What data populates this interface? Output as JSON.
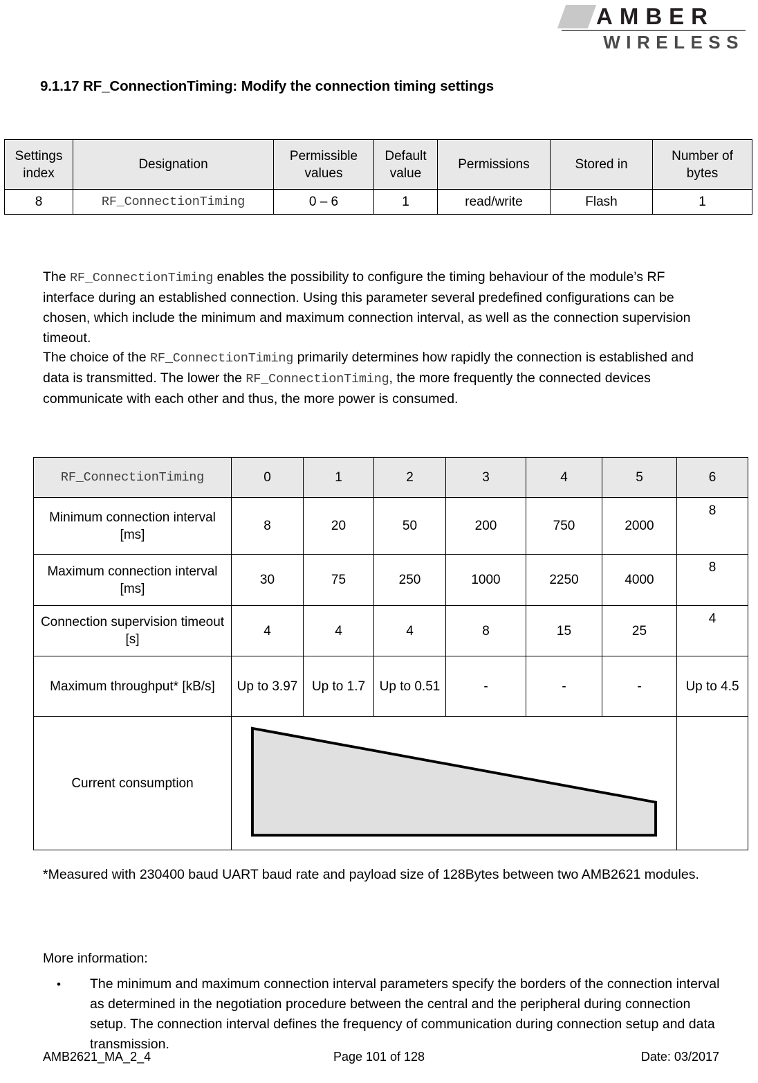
{
  "logo": {
    "line1": "AMBER",
    "line2": "WIRELESS"
  },
  "heading": "9.1.17 RF_ConnectionTiming: Modify the connection timing settings",
  "settings_table": {
    "headers": [
      "Settings index",
      "Designation",
      "Permissible values",
      "Default value",
      "Permissions",
      "Stored in",
      "Number of bytes"
    ],
    "row": {
      "settings_index": "8",
      "designation": "RF_ConnectionTiming",
      "permissible_values": "0 – 6",
      "default_value": "1",
      "permissions": "read/write",
      "stored_in": "Flash",
      "number_of_bytes": "1"
    }
  },
  "paragraphs": {
    "p1": {
      "a": "The ",
      "code1": "RF_ConnectionTiming",
      "b": " enables the possibility to configure the timing behaviour of the module’s RF interface during an established connection. Using this parameter several predefined configurations can be chosen, which include the minimum and maximum connection interval, as well as the connection supervision timeout."
    },
    "p2": {
      "a": "The choice of the ",
      "code1": "RF_ConnectionTiming",
      "b": " primarily determines how rapidly the connection is established and data is transmitted. The lower the ",
      "code2": "RF_ConnectionTiming",
      "c": ", the more frequently the connected devices communicate with each other and thus, the more power is consumed."
    }
  },
  "timing_table": {
    "corner_label": "RF_ConnectionTiming",
    "columns": [
      "0",
      "1",
      "2",
      "3",
      "4",
      "5",
      "6"
    ],
    "rows": [
      {
        "label": "Minimum connection interval [ms]",
        "values": [
          "8",
          "20",
          "50",
          "200",
          "750",
          "2000",
          "8"
        ]
      },
      {
        "label": "Maximum connection interval [ms]",
        "values": [
          "30",
          "75",
          "250",
          "1000",
          "2250",
          "4000",
          "8"
        ]
      },
      {
        "label": "Connection supervision timeout [s]",
        "values": [
          "4",
          "4",
          "4",
          "8",
          "15",
          "25",
          "4"
        ]
      },
      {
        "label": "Maximum throughput* [kB/s]",
        "values": [
          "Up to 3.97",
          "Up to 1.7",
          "Up to 0.51",
          "-",
          "-",
          "-",
          "Up to 4.5"
        ]
      }
    ],
    "consumption_row": {
      "label": "Current consumption",
      "graphic": "descending-wedge",
      "graphic_fill": "#e0e0e0",
      "graphic_stroke": "#000000",
      "last_cell": ""
    }
  },
  "footnote": "*Measured with 230400 baud UART baud rate and payload size of 128Bytes between two AMB2621 modules.",
  "more_information": {
    "title": "More information:",
    "bullet_marker": "•",
    "items": [
      "The minimum and maximum connection interval parameters specify the borders of the connection interval as determined in the negotiation procedure between the central and the peripheral during connection setup. The connection interval defines the frequency of communication during connection setup and data transmission."
    ]
  },
  "footer": {
    "document_id": "AMB2621_MA_2_4",
    "page": "Page 101 of 128",
    "date": "Date: 03/2017"
  }
}
